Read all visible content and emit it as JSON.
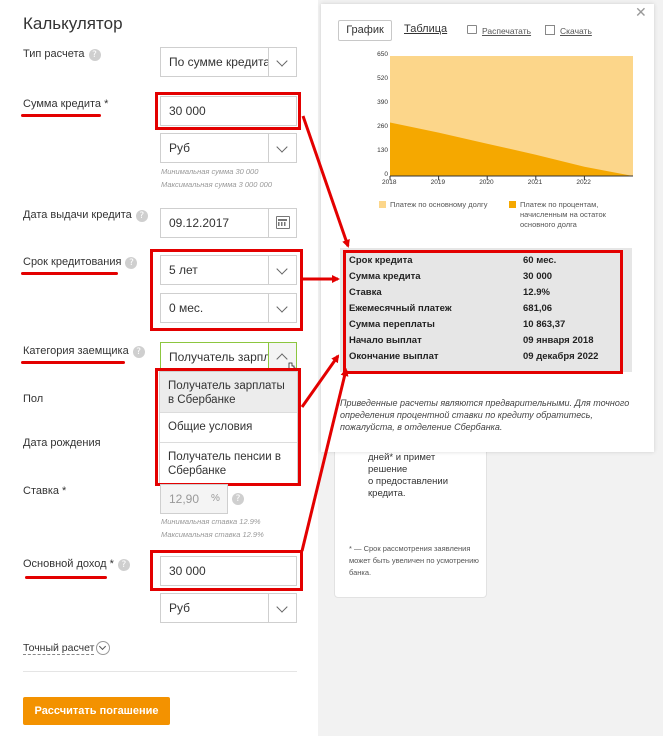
{
  "calculator": {
    "title": "Калькулятор",
    "calc_type": {
      "label": "Тип расчета",
      "value": "По сумме кредита"
    },
    "loan_amount": {
      "label": "Сумма кредита *",
      "value": "30 000",
      "currency": "Руб",
      "min_hint": "Минимальная сумма 30 000",
      "max_hint": "Максимальная сумма 3 000 000"
    },
    "issue_date": {
      "label": "Дата выдачи кредита",
      "value": "09.12.2017"
    },
    "term": {
      "label": "Срок кредитования",
      "years": "5 лет",
      "months": "0 мес."
    },
    "borrower_category": {
      "label": "Категория заемщика",
      "value": "Получатель зарплаты в Сбербанке",
      "options": [
        "Получатель зарплаты в Сбербанке",
        "Общие условия",
        "Получатель пенсии в Сбербанке"
      ]
    },
    "gender": {
      "label": "Пол"
    },
    "birth_date": {
      "label": "Дата рождения"
    },
    "rate": {
      "label": "Ставка *",
      "value": "12,90",
      "unit": "%",
      "min_hint": "Минимальная ставка 12.9%",
      "max_hint": "Максимальная ставка 12.9%"
    },
    "income": {
      "label": "Основной доход *",
      "value": "30 000",
      "currency": "Руб"
    },
    "precise_calc": "Точный расчет",
    "calculate_button": "Рассчитать погашение",
    "help_glyph": "?"
  },
  "popup": {
    "close_glyph": "✕",
    "tab_graph": "График",
    "tab_table": "Таблица",
    "print_link": "Распечатать",
    "download_link": "Скачать",
    "legend": {
      "principal": "Платеж по основному долгу",
      "interest": [
        "Платеж по процентам,",
        "начисленным на остаток",
        "основного долга"
      ]
    },
    "summary": [
      {
        "label": "Срок кредита",
        "value": "60 мес."
      },
      {
        "label": "Сумма кредита",
        "value": "30 000"
      },
      {
        "label": "Ставка",
        "value": "12.9%"
      },
      {
        "label": "Ежемесячный платеж",
        "value": "681,06"
      },
      {
        "label": "Сумма переплаты",
        "value": "10 863,37"
      },
      {
        "label": "Начало выплат",
        "value": "09 января 2018"
      },
      {
        "label": "Окончание выплат",
        "value": "09 декабря 2022"
      }
    ],
    "note": "Приведенные расчеты являются предварительными. Для точного определения процентной ставки по кредиту обратитесь, пожалуйста, в отделение Сбербанка."
  },
  "background_card": {
    "lines": [
      "дней* и примет",
      "решение",
      "о предоставлении",
      "кредита."
    ],
    "footnote": "* — Срок рассмотрения заявления может быть увеличен по усмотрению банка."
  },
  "chart_data": {
    "type": "area",
    "x": [
      2018,
      2019,
      2020,
      2021,
      2022,
      2023
    ],
    "x_ticks": [
      "2018",
      "2019",
      "2020",
      "2021",
      "2022"
    ],
    "y_ticks": [
      "0",
      "130",
      "260",
      "390",
      "520",
      "650"
    ],
    "ylim": [
      0,
      650
    ],
    "series": [
      {
        "name": "Платеж по процентам, начисленным на остаток основного долга",
        "values": [
          681,
          681,
          681,
          681,
          681,
          681
        ],
        "color": "#fcd68a"
      },
      {
        "name": "Платеж по основному долгу",
        "values": [
          290,
          235,
          175,
          115,
          50,
          0
        ],
        "color": "#f5a800"
      }
    ],
    "grid": false
  },
  "colors": {
    "accent": "#f39200",
    "highlight": "#e30000",
    "chart_light": "#fcd68a",
    "chart_dark": "#f5a800"
  }
}
